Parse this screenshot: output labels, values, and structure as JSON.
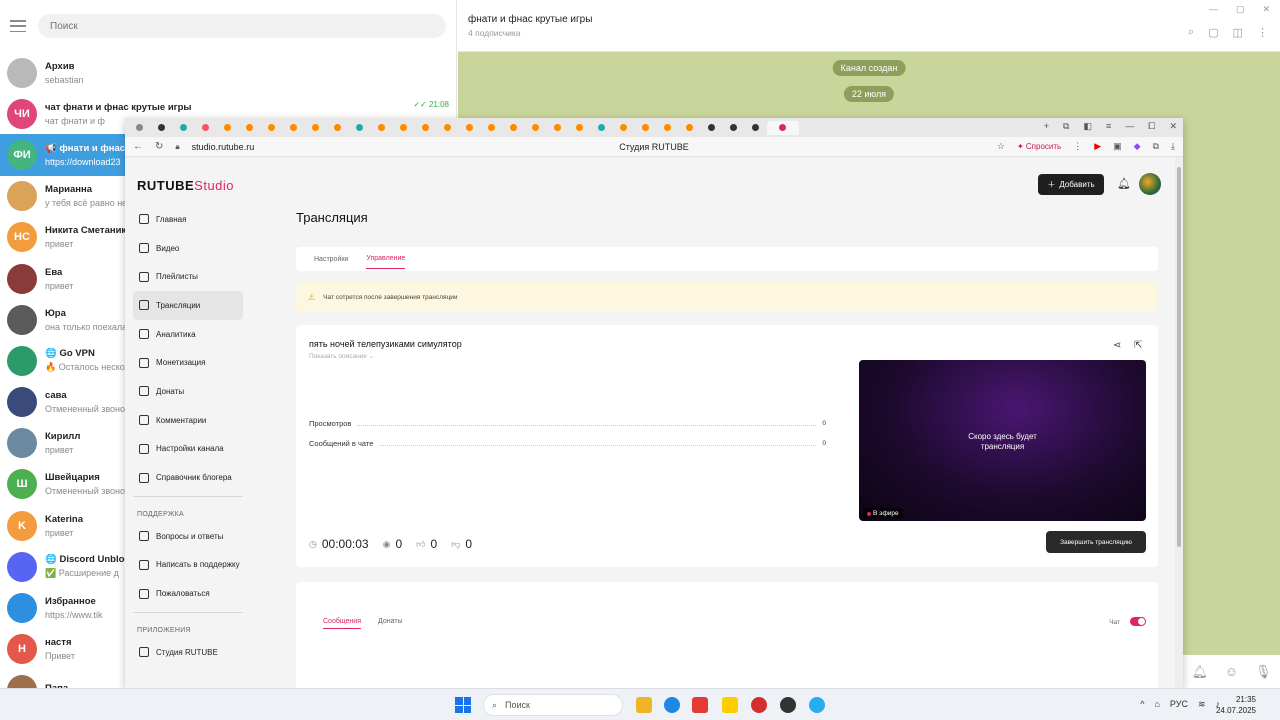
{
  "telegram": {
    "search_placeholder": "Поиск",
    "chats": [
      {
        "avatar": "",
        "color": "#b9b9b9",
        "name": "Архив",
        "sub": "sebastian",
        "time": ""
      },
      {
        "avatar": "ЧИ",
        "color": "#e0457b",
        "name": "чат фнати и фнас крутые игры",
        "sub": "чат фнати и ф",
        "time": "✓✓ 21:08"
      },
      {
        "avatar": "ФИ",
        "color": "#43b581",
        "name": "📢 фнати и фнас к",
        "sub": "https://download23",
        "time": ""
      },
      {
        "avatar": "",
        "color": "#d9a35a",
        "name": "Марианна",
        "sub": "у тебя всё равно не",
        "time": ""
      },
      {
        "avatar": "НС",
        "color": "#f39c3d",
        "name": "Никита Сметаник",
        "sub": "привет",
        "time": ""
      },
      {
        "avatar": "",
        "color": "#8b3a3a",
        "name": "Ева",
        "sub": "привет",
        "time": ""
      },
      {
        "avatar": "",
        "color": "#5b5b5b",
        "name": "Юра",
        "sub": "она только поехала",
        "time": ""
      },
      {
        "avatar": "",
        "color": "#2b9b6a",
        "name": "🌐 Go VPN",
        "sub": "🔥 Осталось несколько",
        "time": ""
      },
      {
        "avatar": "",
        "color": "#3a4a7a",
        "name": "сава",
        "sub": "Отмененный звонок",
        "time": ""
      },
      {
        "avatar": "",
        "color": "#6b8aa0",
        "name": "Кирилл",
        "sub": "привет",
        "time": ""
      },
      {
        "avatar": "Ш",
        "color": "#4caf50",
        "name": "Швейцария",
        "sub": "Отмененный звонок",
        "time": ""
      },
      {
        "avatar": "K",
        "color": "#f39c3d",
        "name": "Katerina",
        "sub": "привет",
        "time": ""
      },
      {
        "avatar": "",
        "color": "#5865f2",
        "name": "🌐 Discord Unblock",
        "sub": "✅ Расширение д",
        "time": ""
      },
      {
        "avatar": "",
        "color": "#2d8fe0",
        "name": "Избранное",
        "sub": "https://www.tik",
        "time": ""
      },
      {
        "avatar": "Н",
        "color": "#e5574a",
        "name": "настя",
        "sub": "Привет",
        "time": ""
      },
      {
        "avatar": "",
        "color": "#9e6f4a",
        "name": "Папа",
        "sub": "",
        "time": ""
      }
    ],
    "chat_title": "фнати и фнас крутые игры",
    "chat_members": "4 подписчика",
    "service_msg_1": "Канал создан",
    "service_msg_2": "22 июля"
  },
  "browser": {
    "url": "studio.rutube.ru",
    "page_title": "Студия RUTUBE",
    "ask_label": "Спросить"
  },
  "studio": {
    "logo_main": "RUTUBE",
    "logo_sub": "Studio",
    "add_label": "Добавить",
    "nav": [
      "Главная",
      "Видео",
      "Плейлисты",
      "Трансляции",
      "Аналитика",
      "Монетизация",
      "Донаты",
      "Комментарии",
      "Настройки канала",
      "Справочник блогера"
    ],
    "support_title": "ПОДДЕРЖКА",
    "support": [
      "Вопросы и ответы",
      "Написать в поддержку",
      "Пожаловаться"
    ],
    "apps_title": "ПРИЛОЖЕНИЯ",
    "apps": [
      "Студия RUTUBE"
    ],
    "heading": "Трансляция",
    "tabs": [
      "Настройки",
      "Управление"
    ],
    "notice": "Чат сотрется после завершения трансляции",
    "stream_title": "пять ночей телепузиками симулятор",
    "show_desc": "Показать описание ⌄",
    "views_label": "Просмотров",
    "views_value": "0",
    "chat_msgs_label": "Сообщений в чате",
    "chat_msgs_value": "0",
    "preview_text": "Скоро здесь будет трансляция",
    "live_badge": "В эфире",
    "timer": "00:00:03",
    "viewers": "0",
    "likes": "0",
    "dislikes": "0",
    "end_button": "Завершить трансляцию",
    "chat_tabs": [
      "Сообщения",
      "Донаты"
    ],
    "chat_toggle_label": "Чат"
  },
  "taskbar": {
    "search": "Поиск",
    "lang": "РУС",
    "time": "21:35",
    "date": "24.07.2025"
  }
}
